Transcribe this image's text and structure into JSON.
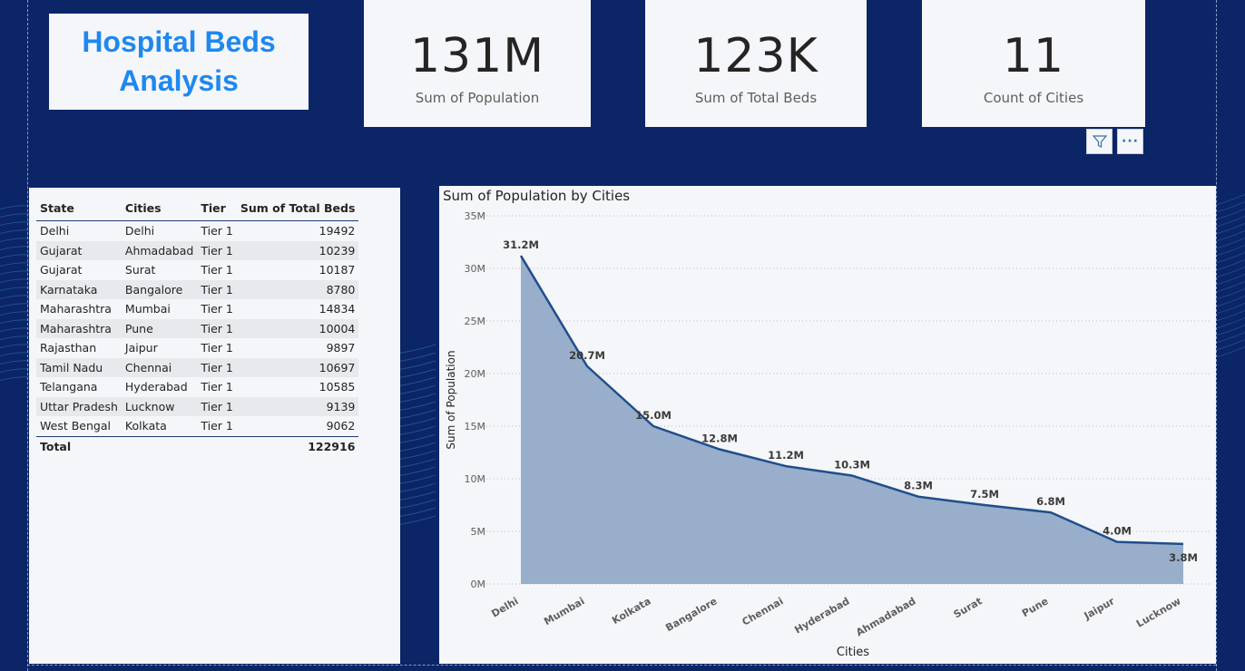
{
  "dashboard": {
    "title": "Hospital Beds Analysis",
    "colors": {
      "background": "#0c2566",
      "title": "#1e88f0",
      "series": "#1f4e8c",
      "area": "#92aac7"
    }
  },
  "cards": [
    {
      "value": "131M",
      "label": "Sum of Population"
    },
    {
      "value": "123K",
      "label": "Sum of Total Beds"
    },
    {
      "value": "11",
      "label": "Count of Cities"
    }
  ],
  "toolbar": {
    "filter_icon": "filter-icon",
    "more_icon": "more-options-icon",
    "more_label": "···"
  },
  "table": {
    "columns": [
      "State",
      "Cities",
      "Tier",
      "Sum of Total Beds"
    ],
    "rows": [
      [
        "Delhi",
        "Delhi",
        "Tier 1",
        "19492"
      ],
      [
        "Gujarat",
        "Ahmadabad",
        "Tier 1",
        "10239"
      ],
      [
        "Gujarat",
        "Surat",
        "Tier 1",
        "10187"
      ],
      [
        "Karnataka",
        "Bangalore",
        "Tier 1",
        "8780"
      ],
      [
        "Maharashtra",
        "Mumbai",
        "Tier 1",
        "14834"
      ],
      [
        "Maharashtra",
        "Pune",
        "Tier 1",
        "10004"
      ],
      [
        "Rajasthan",
        "Jaipur",
        "Tier 1",
        "9897"
      ],
      [
        "Tamil Nadu",
        "Chennai",
        "Tier 1",
        "10697"
      ],
      [
        "Telangana",
        "Hyderabad",
        "Tier 1",
        "10585"
      ],
      [
        "Uttar Pradesh",
        "Lucknow",
        "Tier 1",
        "9139"
      ],
      [
        "West Bengal",
        "Kolkata",
        "Tier 1",
        "9062"
      ]
    ],
    "total": {
      "label": "Total",
      "value": "122916"
    }
  },
  "chart_data": {
    "type": "area",
    "title": "Sum of Population by Cities",
    "xlabel": "Cities",
    "ylabel": "Sum of Population",
    "categories": [
      "Delhi",
      "Mumbai",
      "Kolkata",
      "Bangalore",
      "Chennai",
      "Hyderabad",
      "Ahmadabad",
      "Surat",
      "Pune",
      "Jaipur",
      "Lucknow"
    ],
    "values": [
      31.2,
      20.7,
      15.0,
      12.8,
      11.2,
      10.3,
      8.3,
      7.5,
      6.8,
      4.0,
      3.8
    ],
    "data_labels": [
      "31.2M",
      "20.7M",
      "15.0M",
      "12.8M",
      "11.2M",
      "10.3M",
      "8.3M",
      "7.5M",
      "6.8M",
      "4.0M",
      "3.8M"
    ],
    "yticks": [
      "0M",
      "5M",
      "10M",
      "15M",
      "20M",
      "25M",
      "30M",
      "35M"
    ],
    "ytick_values": [
      0,
      5,
      10,
      15,
      20,
      25,
      30,
      35
    ],
    "ylim": [
      0,
      35
    ],
    "grid": true
  }
}
